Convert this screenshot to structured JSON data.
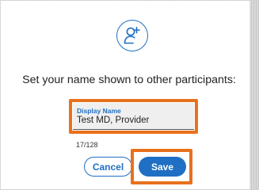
{
  "dialog": {
    "icon": "add-user-icon",
    "heading": "Set your name shown to other participants:",
    "field": {
      "label": "Display Name",
      "value": "Test MD, Provider",
      "counter": "17/128"
    },
    "cancel_label": "Cancel",
    "save_label": "Save"
  },
  "colors": {
    "accent": "#1f6fc4",
    "highlight": "#e8711c"
  }
}
